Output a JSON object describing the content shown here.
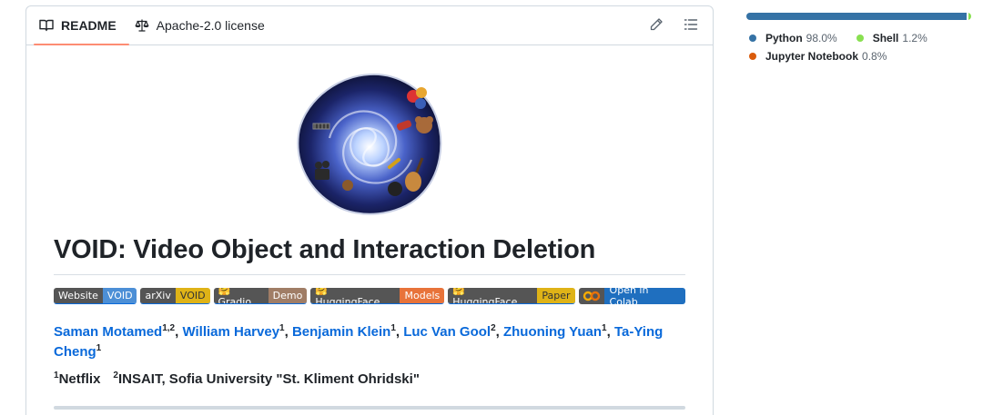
{
  "tabs": [
    {
      "label": "README",
      "icon": "book-icon",
      "active": true
    },
    {
      "label": "Apache-2.0 license",
      "icon": "law-scale-icon",
      "active": false
    }
  ],
  "header_actions": [
    {
      "name": "edit-pencil-icon"
    },
    {
      "name": "outline-list-icon"
    }
  ],
  "readme": {
    "title": "VOID: Video Object and Interaction Deletion",
    "badges": [
      {
        "left": "Website",
        "right": "VOID",
        "color": "#4c8fd6"
      },
      {
        "left": "arXiv",
        "right": "VOID",
        "color": "#dfb317"
      },
      {
        "left": "🤗Gradio",
        "right": "Demo",
        "color": "#a07d66"
      },
      {
        "left": "🤗 HuggingFace",
        "right": "Models",
        "color": "#e8733a"
      },
      {
        "left": "🤗 HuggingFace",
        "right": "Paper",
        "color": "#dfb317"
      }
    ],
    "colab_badge": {
      "right": "Open in Colab"
    },
    "authors": [
      {
        "name": "Saman Motamed",
        "sup": "1,2"
      },
      {
        "name": "William Harvey",
        "sup": "1"
      },
      {
        "name": "Benjamin Klein",
        "sup": "1"
      },
      {
        "name": "Luc Van Gool",
        "sup": "2"
      },
      {
        "name": "Zhuoning Yuan",
        "sup": "1"
      },
      {
        "name": "Ta-Ying Cheng",
        "sup": "1"
      }
    ],
    "separator": ", ",
    "affiliations": [
      {
        "sup": "1",
        "name": "Netflix"
      },
      {
        "sup": "2",
        "name": "INSAIT, Sofia University \"St. Kliment Ohridski\""
      }
    ]
  },
  "languages": [
    {
      "name": "Python",
      "percent": "98.0%",
      "share": 0.98,
      "color": "#3572A5"
    },
    {
      "name": "Shell",
      "percent": "1.2%",
      "share": 0.012,
      "color": "#89e051"
    },
    {
      "name": "Jupyter Notebook",
      "percent": "0.8%",
      "share": 0.008,
      "color": "#DA5B0B"
    }
  ]
}
